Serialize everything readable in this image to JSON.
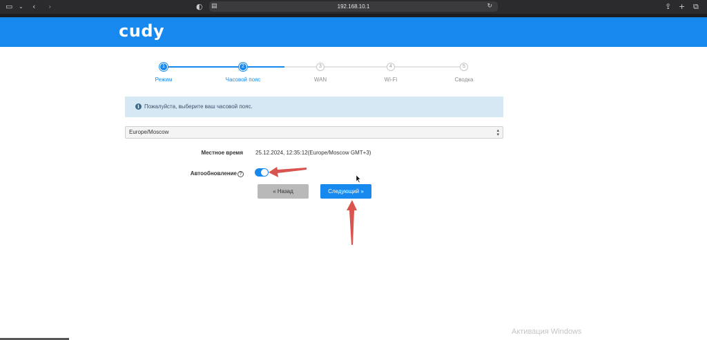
{
  "browser": {
    "url": "192.168.10.1",
    "icons": [
      "sidebar-icon",
      "chevron-down-icon",
      "back-icon",
      "forward-icon",
      "privacy-icon",
      "reader-icon",
      "translate-icon",
      "reload-icon",
      "share-icon",
      "new-tab-icon",
      "tabs-icon"
    ]
  },
  "header": {
    "logo": "cudy",
    "color": "#1788ee"
  },
  "steps": [
    {
      "num": "1",
      "label": "Режим",
      "state": "done"
    },
    {
      "num": "2",
      "label": "Часовой пояс",
      "state": "active"
    },
    {
      "num": "3",
      "label": "WAN",
      "state": "todo"
    },
    {
      "num": "4",
      "label": "Wi-Fi",
      "state": "todo"
    },
    {
      "num": "5",
      "label": "Сводка",
      "state": "todo"
    }
  ],
  "info": {
    "text": "Пожалуйста, выберите ваш часовой пояс."
  },
  "timezone": {
    "selected": "Europe/Moscow"
  },
  "local_time": {
    "label": "Местное время",
    "value": "25.12.2024, 12:35:12(Europe/Moscow GMT+3)"
  },
  "auto_update": {
    "label": "Автообновление",
    "help": "?",
    "enabled": true
  },
  "buttons": {
    "back": "« Назад",
    "next": "Следующий »"
  },
  "watermark": "Активация Windows",
  "colors": {
    "accent": "#1788ee",
    "annotation_arrow": "#d9534f"
  }
}
